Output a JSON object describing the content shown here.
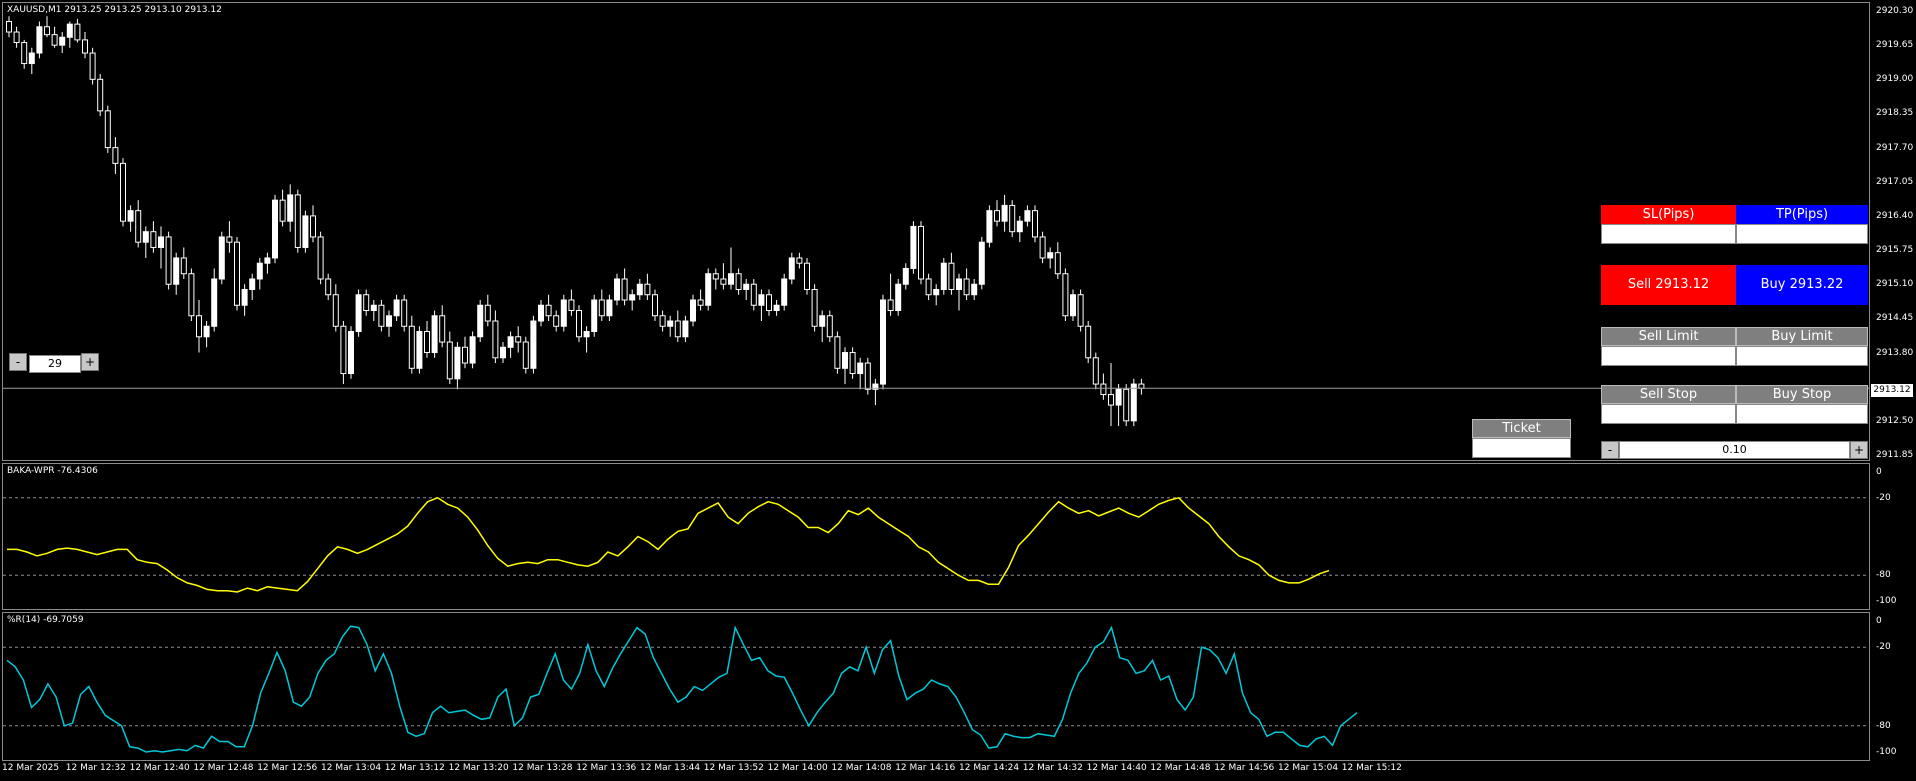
{
  "main_chart": {
    "label": "XAUUSD,M1  2913.25 2913.25 2913.10 2913.12",
    "yaxis_ticks": [
      "2920.30",
      "2919.65",
      "2919.00",
      "2918.35",
      "2917.70",
      "2917.05",
      "2916.40",
      "2915.75",
      "2915.10",
      "2914.45",
      "2913.80",
      "2913.12",
      "2912.50",
      "2911.85"
    ],
    "current_price": "2913.12",
    "ylim": [
      2911.85,
      2920.5
    ],
    "candles": [
      [
        2920.1,
        2920.2,
        2919.8,
        2919.9
      ],
      [
        2919.9,
        2920.0,
        2919.6,
        2919.7
      ],
      [
        2919.7,
        2919.75,
        2919.2,
        2919.3
      ],
      [
        2919.3,
        2919.6,
        2919.1,
        2919.5
      ],
      [
        2919.5,
        2920.1,
        2919.4,
        2920.0
      ],
      [
        2920.0,
        2920.2,
        2919.8,
        2919.85
      ],
      [
        2919.85,
        2920.0,
        2919.6,
        2919.65
      ],
      [
        2919.65,
        2919.9,
        2919.5,
        2919.8
      ],
      [
        2919.8,
        2920.1,
        2919.6,
        2920.05
      ],
      [
        2920.05,
        2920.15,
        2919.7,
        2919.75
      ],
      [
        2919.75,
        2919.9,
        2919.4,
        2919.5
      ],
      [
        2919.5,
        2919.6,
        2918.9,
        2919.0
      ],
      [
        2919.0,
        2919.1,
        2918.3,
        2918.4
      ],
      [
        2918.4,
        2918.5,
        2917.6,
        2917.7
      ],
      [
        2917.7,
        2917.9,
        2917.2,
        2917.4
      ],
      [
        2917.4,
        2917.5,
        2916.2,
        2916.3
      ],
      [
        2916.3,
        2916.6,
        2916.1,
        2916.5
      ],
      [
        2916.5,
        2916.7,
        2915.8,
        2915.9
      ],
      [
        2915.9,
        2916.2,
        2915.6,
        2916.1
      ],
      [
        2916.1,
        2916.3,
        2915.7,
        2915.8
      ],
      [
        2915.8,
        2916.2,
        2915.4,
        2916.0
      ],
      [
        2916.0,
        2916.1,
        2915.0,
        2915.1
      ],
      [
        2915.1,
        2915.7,
        2914.9,
        2915.6
      ],
      [
        2915.6,
        2915.8,
        2915.2,
        2915.3
      ],
      [
        2915.3,
        2915.4,
        2914.4,
        2914.5
      ],
      [
        2914.5,
        2914.8,
        2913.8,
        2914.1
      ],
      [
        2914.1,
        2914.4,
        2913.9,
        2914.3
      ],
      [
        2914.3,
        2915.4,
        2914.2,
        2915.2
      ],
      [
        2915.2,
        2916.1,
        2915.1,
        2916.0
      ],
      [
        2916.0,
        2916.3,
        2915.7,
        2915.9
      ],
      [
        2915.9,
        2916.0,
        2914.6,
        2914.7
      ],
      [
        2914.7,
        2915.1,
        2914.5,
        2915.0
      ],
      [
        2915.0,
        2915.3,
        2914.8,
        2915.2
      ],
      [
        2915.2,
        2915.6,
        2915.0,
        2915.5
      ],
      [
        2915.5,
        2915.7,
        2915.3,
        2915.6
      ],
      [
        2915.6,
        2916.8,
        2915.5,
        2916.7
      ],
      [
        2916.7,
        2916.9,
        2916.2,
        2916.3
      ],
      [
        2916.3,
        2917.0,
        2916.1,
        2916.8
      ],
      [
        2916.8,
        2916.9,
        2915.7,
        2915.8
      ],
      [
        2915.8,
        2916.5,
        2915.7,
        2916.4
      ],
      [
        2916.4,
        2916.6,
        2915.9,
        2916.0
      ],
      [
        2916.0,
        2916.1,
        2915.1,
        2915.2
      ],
      [
        2915.2,
        2915.3,
        2914.8,
        2914.9
      ],
      [
        2914.9,
        2915.1,
        2914.2,
        2914.3
      ],
      [
        2914.3,
        2914.4,
        2913.2,
        2913.4
      ],
      [
        2913.4,
        2914.3,
        2913.3,
        2914.2
      ],
      [
        2914.2,
        2915.0,
        2914.1,
        2914.9
      ],
      [
        2914.9,
        2915.0,
        2914.5,
        2914.6
      ],
      [
        2914.6,
        2914.8,
        2914.4,
        2914.7
      ],
      [
        2914.7,
        2914.8,
        2914.2,
        2914.3
      ],
      [
        2914.3,
        2914.6,
        2914.1,
        2914.5
      ],
      [
        2914.5,
        2914.9,
        2914.4,
        2914.8
      ],
      [
        2914.8,
        2914.9,
        2914.2,
        2914.3
      ],
      [
        2914.3,
        2914.5,
        2913.4,
        2913.5
      ],
      [
        2913.5,
        2914.3,
        2913.4,
        2914.2
      ],
      [
        2914.2,
        2914.4,
        2913.7,
        2913.8
      ],
      [
        2913.8,
        2914.6,
        2913.7,
        2914.5
      ],
      [
        2914.5,
        2914.7,
        2913.9,
        2914.0
      ],
      [
        2914.0,
        2914.2,
        2913.2,
        2913.3
      ],
      [
        2913.3,
        2914.0,
        2913.1,
        2913.9
      ],
      [
        2913.9,
        2914.1,
        2913.5,
        2913.6
      ],
      [
        2913.6,
        2914.2,
        2913.5,
        2914.1
      ],
      [
        2914.1,
        2914.8,
        2914.0,
        2914.7
      ],
      [
        2914.7,
        2914.9,
        2914.3,
        2914.4
      ],
      [
        2914.4,
        2914.6,
        2913.6,
        2913.7
      ],
      [
        2913.7,
        2914.0,
        2913.6,
        2913.9
      ],
      [
        2913.9,
        2914.2,
        2913.7,
        2914.1
      ],
      [
        2914.1,
        2914.3,
        2913.8,
        2914.0
      ],
      [
        2914.0,
        2914.1,
        2913.4,
        2913.5
      ],
      [
        2913.5,
        2914.5,
        2913.4,
        2914.4
      ],
      [
        2914.4,
        2914.8,
        2914.3,
        2914.7
      ],
      [
        2914.7,
        2914.9,
        2914.4,
        2914.5
      ],
      [
        2914.5,
        2914.6,
        2914.2,
        2914.3
      ],
      [
        2914.3,
        2914.9,
        2914.2,
        2914.8
      ],
      [
        2914.8,
        2915.0,
        2914.5,
        2914.6
      ],
      [
        2914.6,
        2914.7,
        2914.0,
        2914.1
      ],
      [
        2914.1,
        2914.3,
        2913.8,
        2914.2
      ],
      [
        2914.2,
        2914.9,
        2914.1,
        2914.8
      ],
      [
        2914.8,
        2915.0,
        2914.4,
        2914.5
      ],
      [
        2914.5,
        2914.9,
        2914.4,
        2914.8
      ],
      [
        2914.8,
        2915.3,
        2914.7,
        2915.2
      ],
      [
        2915.2,
        2915.4,
        2914.7,
        2914.8
      ],
      [
        2914.8,
        2915.0,
        2914.6,
        2914.9
      ],
      [
        2914.9,
        2915.2,
        2914.8,
        2915.1
      ],
      [
        2915.1,
        2915.3,
        2914.8,
        2914.9
      ],
      [
        2914.9,
        2915.0,
        2914.4,
        2914.5
      ],
      [
        2914.5,
        2914.6,
        2914.2,
        2914.3
      ],
      [
        2914.3,
        2914.5,
        2914.1,
        2914.4
      ],
      [
        2914.4,
        2914.6,
        2914.0,
        2914.1
      ],
      [
        2914.1,
        2914.5,
        2914.0,
        2914.4
      ],
      [
        2914.4,
        2914.9,
        2914.3,
        2914.8
      ],
      [
        2914.8,
        2915.0,
        2914.6,
        2914.7
      ],
      [
        2914.7,
        2915.4,
        2914.6,
        2915.3
      ],
      [
        2915.3,
        2915.4,
        2915.0,
        2915.2
      ],
      [
        2915.2,
        2915.5,
        2915.0,
        2915.1
      ],
      [
        2915.1,
        2915.8,
        2915.0,
        2915.3
      ],
      [
        2915.3,
        2915.4,
        2914.9,
        2915.0
      ],
      [
        2915.0,
        2915.2,
        2914.8,
        2915.1
      ],
      [
        2915.1,
        2915.2,
        2914.6,
        2914.7
      ],
      [
        2914.7,
        2915.0,
        2914.4,
        2914.9
      ],
      [
        2914.9,
        2915.0,
        2914.5,
        2914.6
      ],
      [
        2914.6,
        2914.8,
        2914.5,
        2914.7
      ],
      [
        2914.7,
        2915.3,
        2914.6,
        2915.2
      ],
      [
        2915.2,
        2915.7,
        2915.1,
        2915.6
      ],
      [
        2915.6,
        2915.7,
        2915.4,
        2915.5
      ],
      [
        2915.5,
        2915.6,
        2914.9,
        2915.0
      ],
      [
        2915.0,
        2915.1,
        2914.2,
        2914.3
      ],
      [
        2914.3,
        2914.6,
        2914.0,
        2914.5
      ],
      [
        2914.5,
        2914.6,
        2914.0,
        2914.1
      ],
      [
        2914.1,
        2914.2,
        2913.4,
        2913.5
      ],
      [
        2913.5,
        2913.9,
        2913.2,
        2913.8
      ],
      [
        2913.8,
        2913.9,
        2913.3,
        2913.4
      ],
      [
        2913.4,
        2913.7,
        2913.1,
        2913.6
      ],
      [
        2913.6,
        2913.7,
        2913.0,
        2913.1
      ],
      [
        2913.1,
        2913.3,
        2912.8,
        2913.2
      ],
      [
        2913.2,
        2914.9,
        2913.1,
        2914.8
      ],
      [
        2914.8,
        2915.3,
        2914.5,
        2914.6
      ],
      [
        2914.6,
        2915.2,
        2914.5,
        2915.1
      ],
      [
        2915.1,
        2915.5,
        2915.0,
        2915.4
      ],
      [
        2915.4,
        2916.3,
        2915.3,
        2916.2
      ],
      [
        2916.2,
        2916.3,
        2915.1,
        2915.2
      ],
      [
        2915.2,
        2915.3,
        2914.8,
        2914.9
      ],
      [
        2914.9,
        2915.1,
        2914.7,
        2915.0
      ],
      [
        2915.0,
        2915.6,
        2914.9,
        2915.5
      ],
      [
        2915.5,
        2915.7,
        2914.9,
        2915.0
      ],
      [
        2915.0,
        2915.3,
        2914.6,
        2915.2
      ],
      [
        2915.2,
        2915.4,
        2914.8,
        2914.9
      ],
      [
        2914.9,
        2915.2,
        2914.8,
        2915.1
      ],
      [
        2915.1,
        2916.0,
        2915.0,
        2915.9
      ],
      [
        2915.9,
        2916.6,
        2915.8,
        2916.5
      ],
      [
        2916.5,
        2916.7,
        2916.2,
        2916.3
      ],
      [
        2916.3,
        2916.8,
        2916.1,
        2916.6
      ],
      [
        2916.6,
        2916.7,
        2916.0,
        2916.1
      ],
      [
        2916.1,
        2916.4,
        2915.9,
        2916.3
      ],
      [
        2916.3,
        2916.6,
        2916.2,
        2916.5
      ],
      [
        2916.5,
        2916.6,
        2915.9,
        2916.0
      ],
      [
        2916.0,
        2916.1,
        2915.5,
        2915.6
      ],
      [
        2915.6,
        2915.8,
        2915.4,
        2915.7
      ],
      [
        2915.7,
        2915.9,
        2915.2,
        2915.3
      ],
      [
        2915.3,
        2915.4,
        2914.4,
        2914.5
      ],
      [
        2914.5,
        2915.0,
        2914.4,
        2914.9
      ],
      [
        2914.9,
        2915.0,
        2914.2,
        2914.3
      ],
      [
        2914.3,
        2914.4,
        2913.6,
        2913.7
      ],
      [
        2913.7,
        2913.8,
        2913.1,
        2913.2
      ],
      [
        2913.2,
        2913.4,
        2912.9,
        2913.0
      ],
      [
        2913.0,
        2913.6,
        2912.4,
        2912.8
      ],
      [
        2912.8,
        2913.2,
        2912.4,
        2913.1
      ],
      [
        2913.1,
        2913.2,
        2912.4,
        2912.5
      ],
      [
        2912.5,
        2913.3,
        2912.4,
        2913.2
      ],
      [
        2913.2,
        2913.3,
        2913.0,
        2913.12
      ]
    ]
  },
  "baka_wpr": {
    "label": "BAKA-WPR -76.4306",
    "yaxis_ticks": [
      "0",
      "-20",
      "-80",
      "-100"
    ],
    "values": [
      -60,
      -60,
      -62,
      -65,
      -63,
      -60,
      -59,
      -60,
      -62,
      -64,
      -62,
      -60,
      -60,
      -68,
      -70,
      -71,
      -76,
      -82,
      -86,
      -88,
      -91,
      -92,
      -92,
      -93,
      -90,
      -92,
      -89,
      -90,
      -91,
      -92,
      -85,
      -75,
      -65,
      -58,
      -60,
      -63,
      -60,
      -56,
      -52,
      -48,
      -42,
      -32,
      -23,
      -20,
      -25,
      -28,
      -35,
      -45,
      -57,
      -67,
      -73,
      -71,
      -70,
      -71,
      -68,
      -68,
      -70,
      -72,
      -73,
      -70,
      -62,
      -65,
      -58,
      -50,
      -54,
      -60,
      -52,
      -46,
      -44,
      -32,
      -28,
      -24,
      -35,
      -40,
      -32,
      -27,
      -23,
      -25,
      -30,
      -35,
      -43,
      -43,
      -47,
      -40,
      -30,
      -33,
      -28,
      -35,
      -40,
      -45,
      -50,
      -58,
      -62,
      -70,
      -75,
      -80,
      -84,
      -84,
      -87,
      -87,
      -74,
      -57,
      -49,
      -40,
      -31,
      -23,
      -28,
      -32,
      -30,
      -34,
      -31,
      -28,
      -32,
      -35,
      -30,
      -25,
      -22,
      -20,
      -28,
      -34,
      -40,
      -50,
      -58,
      -65,
      -68,
      -72,
      -80,
      -84,
      -86,
      -86,
      -83,
      -79,
      -76.43
    ]
  },
  "wpr14": {
    "label": "%R(14) -69.7059",
    "yaxis_ticks": [
      "0",
      "-20",
      "-80",
      "-100"
    ],
    "values": [
      -30,
      -35,
      -45,
      -66,
      -60,
      -48,
      -58,
      -80,
      -78,
      -56,
      -50,
      -62,
      -72,
      -76,
      -80,
      -96,
      -97,
      -100,
      -99,
      -100,
      -99,
      -98,
      -99,
      -95,
      -97,
      -88,
      -92,
      -92,
      -96,
      -96,
      -80,
      -55,
      -40,
      -24,
      -38,
      -62,
      -65,
      -58,
      -40,
      -30,
      -25,
      -12,
      -4,
      -5,
      -18,
      -38,
      -25,
      -40,
      -65,
      -85,
      -88,
      -86,
      -70,
      -65,
      -70,
      -69,
      -68,
      -72,
      -75,
      -74,
      -58,
      -52,
      -80,
      -74,
      -58,
      -56,
      -40,
      -25,
      -45,
      -52,
      -40,
      -18,
      -38,
      -50,
      -36,
      -25,
      -15,
      -5,
      -10,
      -28,
      -40,
      -52,
      -62,
      -58,
      -50,
      -53,
      -48,
      -43,
      -40,
      -5,
      -18,
      -30,
      -28,
      -38,
      -42,
      -43,
      -55,
      -68,
      -80,
      -70,
      -62,
      -55,
      -40,
      -35,
      -38,
      -20,
      -40,
      -22,
      -15,
      -42,
      -60,
      -55,
      -52,
      -45,
      -48,
      -50,
      -58,
      -70,
      -83,
      -87,
      -97,
      -96,
      -86,
      -88,
      -89,
      -89,
      -86,
      -87,
      -88,
      -75,
      -55,
      -40,
      -32,
      -20,
      -16,
      -5,
      -28,
      -30,
      -40,
      -38,
      -30,
      -45,
      -42,
      -60,
      -68,
      -58,
      -20,
      -22,
      -28,
      -40,
      -25,
      -55,
      -70,
      -75,
      -88,
      -85,
      -85,
      -90,
      -95,
      -96,
      -90,
      -88,
      -95,
      -80,
      -75,
      -70
    ]
  },
  "xaxis_ticks": [
    "12 Mar 2025",
    "12 Mar 12:32",
    "12 Mar 12:40",
    "12 Mar 12:48",
    "12 Mar 12:56",
    "12 Mar 13:04",
    "12 Mar 13:12",
    "12 Mar 13:20",
    "12 Mar 13:28",
    "12 Mar 13:36",
    "12 Mar 13:44",
    "12 Mar 13:52",
    "12 Mar 14:00",
    "12 Mar 14:08",
    "12 Mar 14:16",
    "12 Mar 14:24",
    "12 Mar 14:32",
    "12 Mar 14:40",
    "12 Mar 14:48",
    "12 Mar 14:56",
    "12 Mar 15:04",
    "12 Mar 15:12"
  ],
  "panel": {
    "sl_label": "SL(Pips)",
    "tp_label": "TP(Pips)",
    "sell_label": "Sell 2913.12",
    "buy_label": "Buy 2913.22",
    "sell_limit_label": "Sell Limit",
    "buy_limit_label": "Buy Limit",
    "sell_stop_label": "Sell Stop",
    "buy_stop_label": "Buy Stop",
    "ticket_label": "Ticket",
    "lot_value": "0.10",
    "minus": "-",
    "plus": "+",
    "colors": {
      "sell": "#ff0000",
      "buy": "#0000ff",
      "gray": "#7f7f7f"
    }
  },
  "zoom_control": {
    "minus": "-",
    "plus": "+",
    "value": "29"
  }
}
